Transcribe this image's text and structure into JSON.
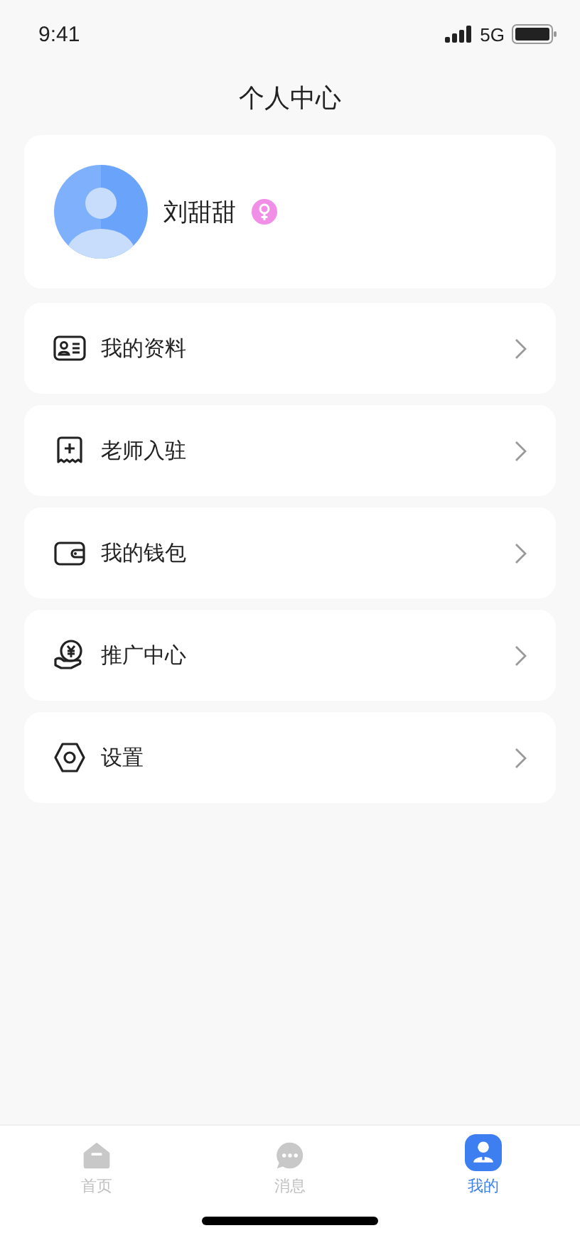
{
  "status_bar": {
    "time": "9:41",
    "network": "5G"
  },
  "header": {
    "title": "个人中心"
  },
  "profile": {
    "name": "刘甜甜",
    "gender": {
      "kind": "female"
    }
  },
  "menu": [
    {
      "kind": "profile",
      "label": "我的资料"
    },
    {
      "kind": "teacher",
      "label": "老师入驻"
    },
    {
      "kind": "wallet",
      "label": "我的钱包"
    },
    {
      "kind": "promotion",
      "label": "推广中心"
    },
    {
      "kind": "settings",
      "label": "设置"
    }
  ],
  "tab_bar": [
    {
      "kind": "home",
      "label": "首页",
      "selected": false
    },
    {
      "kind": "message",
      "label": "消息",
      "selected": false
    },
    {
      "kind": "me",
      "label": "我的",
      "selected": true
    }
  ]
}
